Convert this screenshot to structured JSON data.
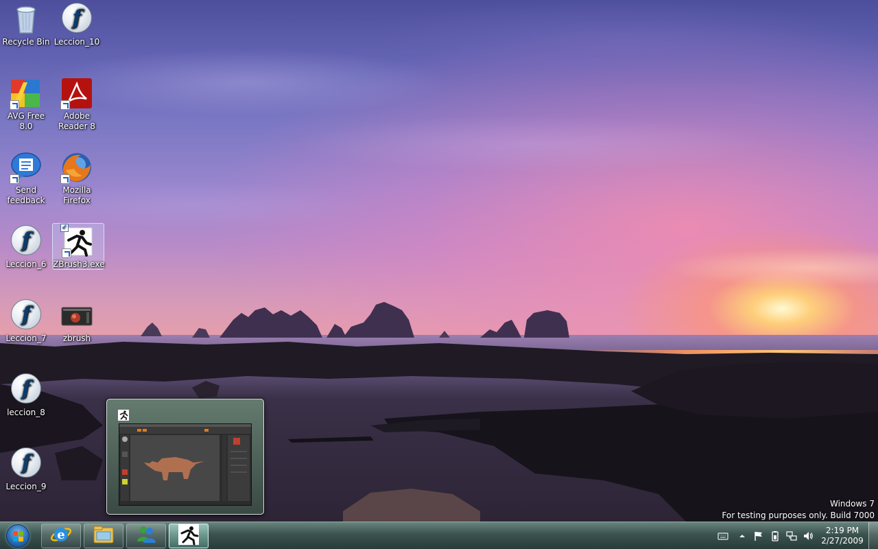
{
  "desktop": {
    "icons": [
      {
        "label": "Recycle Bin",
        "icon": "recycle-bin-icon"
      },
      {
        "label": "Leccion_10",
        "icon": "flash-icon"
      },
      {
        "label": "AVG Free 8.0",
        "icon": "avg-icon"
      },
      {
        "label": "Adobe Reader 8",
        "icon": "adobe-reader-icon"
      },
      {
        "label": "Send feedback",
        "icon": "feedback-icon"
      },
      {
        "label": "Mozilla Firefox",
        "icon": "firefox-icon"
      },
      {
        "label": "Leccion_6",
        "icon": "flash-icon"
      },
      {
        "label": "ZBrush3.exe",
        "icon": "zbrush-icon"
      },
      {
        "label": "Leccion_7",
        "icon": "flash-icon"
      },
      {
        "label": "zbrush",
        "icon": "zbrush-image-icon"
      },
      {
        "label": "leccion_8",
        "icon": "flash-icon"
      },
      {
        "label": "Leccion_9",
        "icon": "flash-icon"
      }
    ],
    "watermark": {
      "line1": "Windows  7",
      "line2": "For testing purposes only. Build 7000"
    }
  },
  "thumbnail": {
    "app_icon": "zbrush-icon",
    "content": "zbrush-window-preview"
  },
  "taskbar": {
    "start_icon": "windows-start-orb-icon",
    "pinned": [
      {
        "icon": "internet-explorer-icon"
      },
      {
        "icon": "windows-explorer-icon"
      },
      {
        "icon": "windows-live-messenger-icon"
      },
      {
        "icon": "zbrush-icon",
        "active": true
      }
    ],
    "tray_icons": [
      "keyboard-icon",
      "show-hidden-icons-icon",
      "action-center-flag-icon",
      "battery-icon",
      "network-icon",
      "volume-icon"
    ],
    "clock": {
      "time": "2:19 PM",
      "date": "2/27/2009"
    }
  },
  "colors": {
    "taskbar": "#3c5652",
    "sky_top": "#4d4f9c",
    "sunset": "#ff9a6a"
  }
}
